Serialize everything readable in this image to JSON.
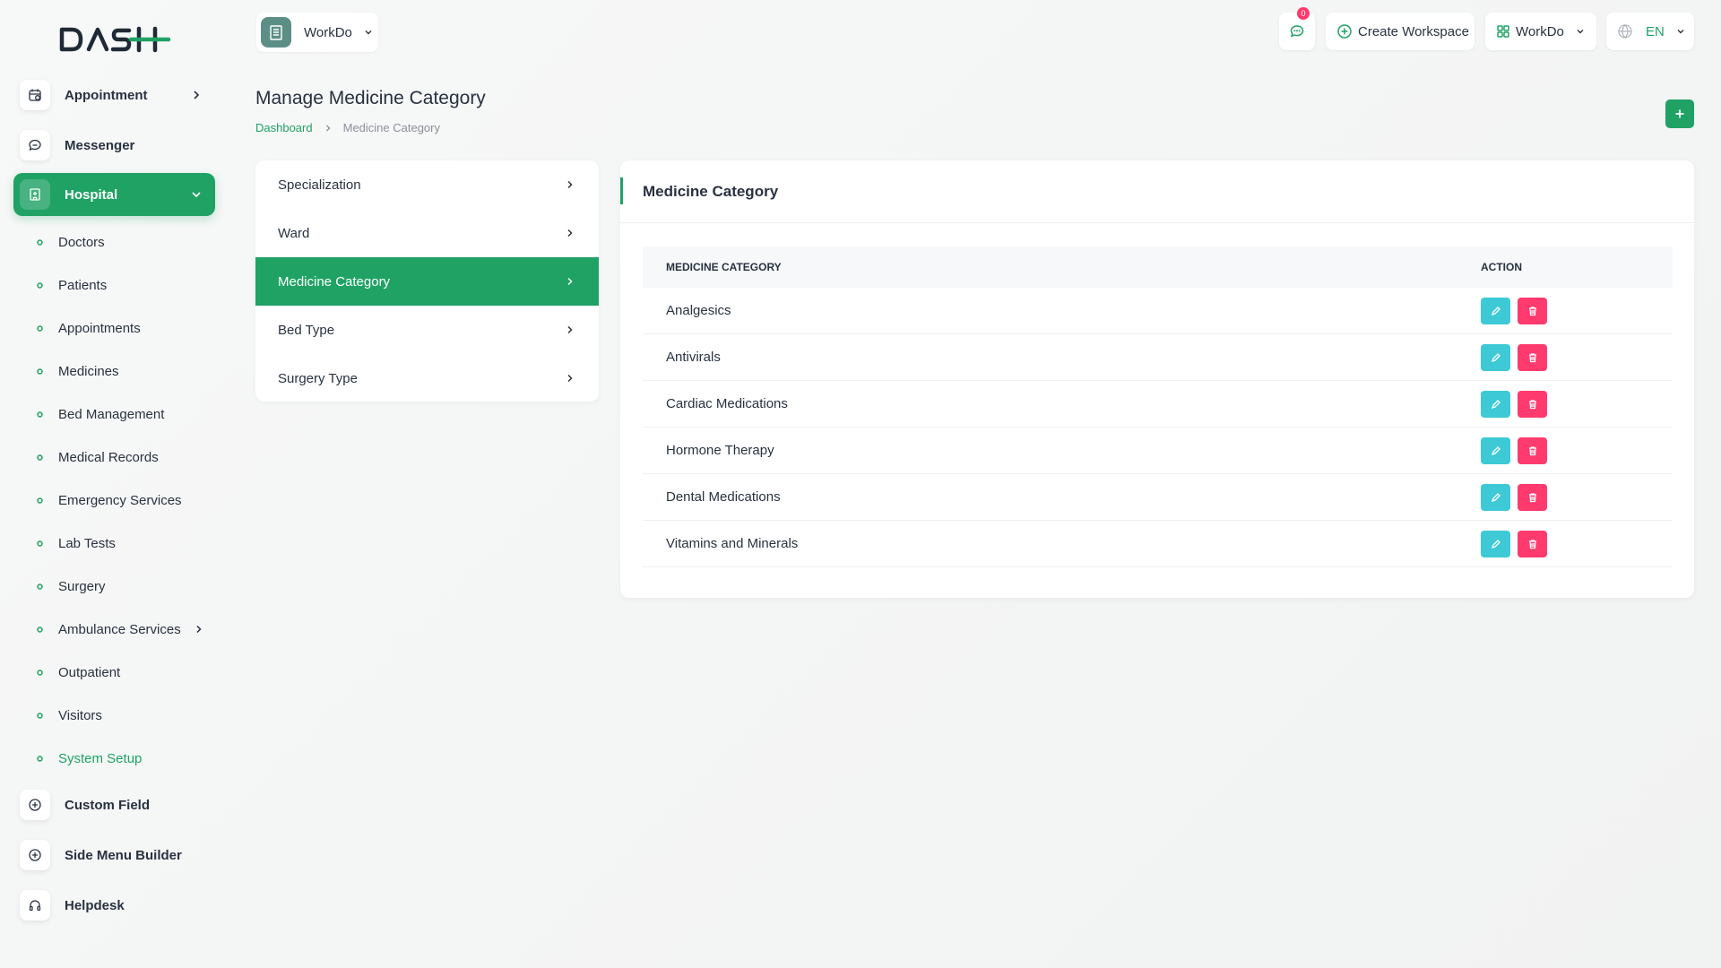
{
  "colors": {
    "accent": "#20a264",
    "edit": "#3ec9d6",
    "delete": "#ff3a6e"
  },
  "sidebar": {
    "logo_text": "DASH",
    "top_items": [
      {
        "label": "Appointment",
        "icon": "calendar-icon"
      },
      {
        "label": "Messenger",
        "icon": "chat-icon"
      },
      {
        "label": "Hospital",
        "icon": "hospital-icon"
      }
    ],
    "sub_items": [
      "Doctors",
      "Patients",
      "Appointments",
      "Medicines",
      "Bed Management",
      "Medical Records",
      "Emergency Services",
      "Lab Tests",
      "Surgery",
      "Ambulance Services",
      "Outpatient",
      "Visitors",
      "System Setup"
    ],
    "bottom_items": [
      {
        "label": "Custom Field",
        "icon": "plus-circle-icon"
      },
      {
        "label": "Side Menu Builder",
        "icon": "plus-circle-icon"
      },
      {
        "label": "Helpdesk",
        "icon": "headset-icon"
      }
    ]
  },
  "header": {
    "workspace_name": "WorkDo",
    "notification_count": "0",
    "create_workspace_label": "Create Workspace",
    "workspace_menu_label": "WorkDo",
    "language_label": "EN"
  },
  "page": {
    "title": "Manage Medicine Category",
    "breadcrumb_home": "Dashboard",
    "breadcrumb_current": "Medicine Category"
  },
  "setup_nav": [
    "Specialization",
    "Ward",
    "Medicine Category",
    "Bed Type",
    "Surgery Type"
  ],
  "card": {
    "title": "Medicine Category",
    "columns": [
      "MEDICINE CATEGORY",
      "ACTION"
    ],
    "rows": [
      "Analgesics",
      "Antivirals",
      "Cardiac Medications",
      "Hormone Therapy",
      "Dental Medications",
      "Vitamins and Minerals"
    ]
  }
}
